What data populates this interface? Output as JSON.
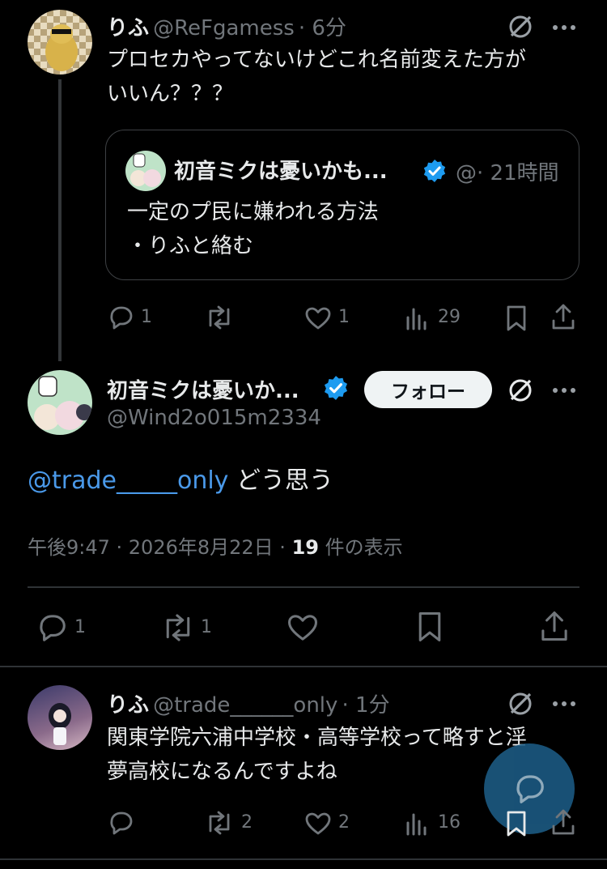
{
  "colors": {
    "background": "#000000",
    "text": "#e7e9ea",
    "muted": "#71767b",
    "link": "#4a99e9",
    "verified": "#1d9bf0",
    "fab": "#1d5f8a"
  },
  "post1": {
    "name": "りふ",
    "handle": "@ReFgamess",
    "time": "· 6分",
    "text_line1": "プロセカやってないけどこれ名前変えた方が",
    "text_line2": "いいん？？？",
    "quote": {
      "name": "初音ミクは憂いかも...",
      "handle": "@",
      "time": "· 21時間",
      "line1": "一定のプ民に嫌われる方法",
      "line2": "・りふと絡む"
    },
    "actions": {
      "replies": "1",
      "reposts": "",
      "likes": "1",
      "views": "29"
    }
  },
  "main": {
    "name": "初音ミクは憂いか...",
    "handle": "@Wind2o015m2334",
    "follow_label": "フォロー",
    "mention": "@trade_____only",
    "text_rest": " どう思う",
    "meta_time": "午後9:47 · 2026年8月22日 · ",
    "meta_views_count": "19",
    "meta_views_label": " 件の表示",
    "actions": {
      "replies": "1",
      "reposts": "1"
    }
  },
  "reply": {
    "name": "りふ",
    "handle": "@trade______only",
    "time": "· 1分",
    "text_line1": "関東学院六浦中学校・高等学校って略すと淫",
    "text_line2": "夢高校になるんですよね",
    "actions": {
      "replies": "",
      "reposts": "2",
      "likes": "2",
      "views": "16"
    }
  },
  "icons": [
    "reply-icon",
    "repost-icon",
    "like-icon",
    "views-icon",
    "bookmark-icon",
    "share-icon",
    "grok-icon",
    "more-icon",
    "verified-badge-icon",
    "compose-reply-icon"
  ]
}
